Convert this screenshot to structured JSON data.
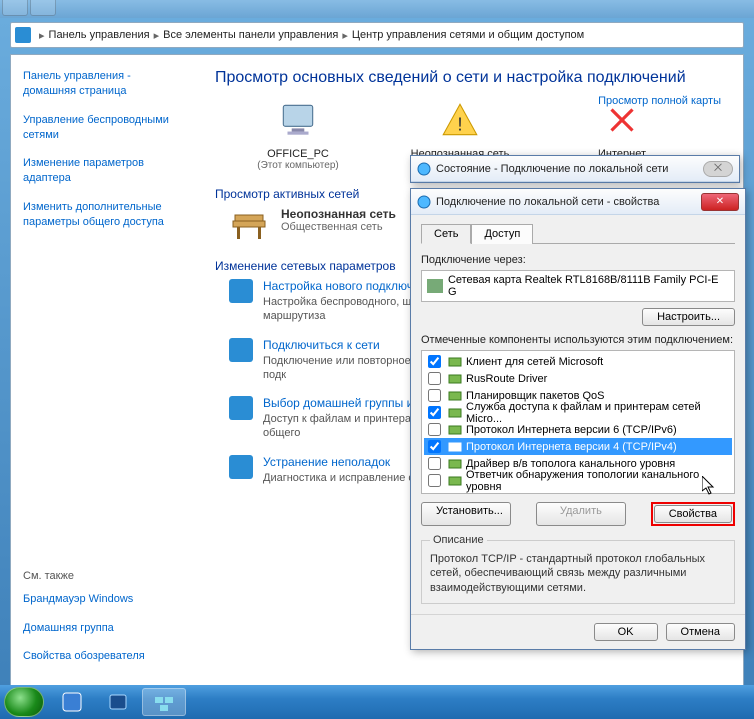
{
  "breadcrumb": {
    "root": "Панель управления",
    "mid": "Все элементы панели управления",
    "leaf": "Центр управления сетями и общим доступом"
  },
  "sidebar": {
    "home": "Панель управления - домашняя страница",
    "wireless": "Управление беспроводными сетями",
    "adapter": "Изменение параметров адаптера",
    "sharing": "Изменить дополнительные параметры общего доступа",
    "also_label": "См. также",
    "firewall": "Брандмауэр Windows",
    "homegroup": "Домашняя группа",
    "internet": "Свойства обозревателя"
  },
  "content": {
    "title": "Просмотр основных сведений о сети и настройка подключений",
    "fullmap": "Просмотр полной карты",
    "pc": {
      "name": "OFFICE_PC",
      "sub": "(Этот компьютер)"
    },
    "unk": {
      "name": "Неопознанная сеть"
    },
    "inet": {
      "name": "Интернет"
    },
    "active_hdr": "Просмотр активных сетей",
    "active": {
      "name": "Неопознанная сеть",
      "type": "Общественная сеть"
    },
    "params_hdr": "Изменение сетевых параметров",
    "tasks": [
      {
        "link": "Настройка нового подключени",
        "desc": "Настройка беспроводного, ши или же настройка маршрутиза"
      },
      {
        "link": "Подключиться к сети",
        "desc": "Подключение или повторное п сетевому соединению или подк"
      },
      {
        "link": "Выбор домашней группы и пар",
        "desc": "Доступ к файлам и принтерам, изменение параметров общего"
      },
      {
        "link": "Устранение неполадок",
        "desc": "Диагностика и исправление се"
      }
    ]
  },
  "dlg_status": {
    "title": "Состояние - Подключение по локальной сети"
  },
  "dlg_props": {
    "title": "Подключение по локальной сети - свойства",
    "tab_net": "Сеть",
    "tab_access": "Доступ",
    "conn_via": "Подключение через:",
    "adapter": "Сетевая карта Realtek RTL8168B/8111B Family PCI-E G",
    "configure": "Настроить...",
    "components_label": "Отмеченные компоненты используются этим подключением:",
    "components": [
      {
        "checked": true,
        "label": "Клиент для сетей Microsoft"
      },
      {
        "checked": false,
        "label": "RusRoute Driver"
      },
      {
        "checked": false,
        "label": "Планировщик пакетов QoS"
      },
      {
        "checked": true,
        "label": "Служба доступа к файлам и принтерам сетей Micro..."
      },
      {
        "checked": false,
        "label": "Протокол Интернета версии 6 (TCP/IPv6)"
      },
      {
        "checked": true,
        "label": "Протокол Интернета версии 4 (TCP/IPv4)",
        "selected": true
      },
      {
        "checked": false,
        "label": "Драйвер в/в тополога канального уровня"
      },
      {
        "checked": false,
        "label": "Ответчик обнаружения топологии канального уровня"
      }
    ],
    "install": "Установить...",
    "uninstall": "Удалить",
    "properties": "Свойства",
    "desc_hdr": "Описание",
    "desc_text": "Протокол TCP/IP - стандартный протокол глобальных сетей, обеспечивающий связь между различными взаимодействующими сетями.",
    "ok": "OK",
    "cancel": "Отмена"
  }
}
